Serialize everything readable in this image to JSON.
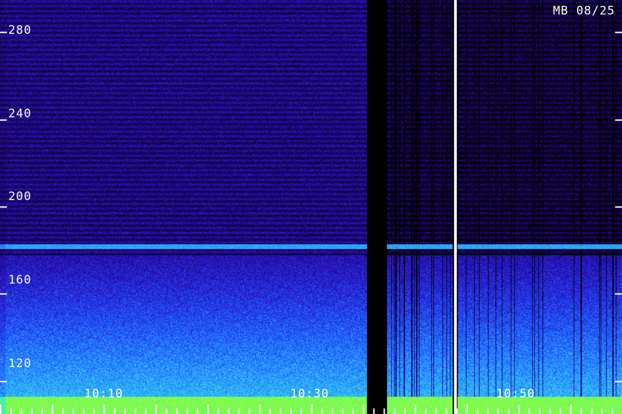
{
  "chart_data": {
    "type": "heatmap",
    "title": "MB 08/25",
    "xlabel": "",
    "ylabel": "",
    "x_ticks": [
      "10:10",
      "10:30",
      "10:50"
    ],
    "y_ticks": [
      120,
      160,
      200,
      240,
      280
    ],
    "ylim": [
      105,
      295
    ],
    "colormap": [
      "#000000",
      "#1a0566",
      "#2a10c0",
      "#1e5cff",
      "#33c0ff",
      "#30f0c0",
      "#a0ff20"
    ],
    "legend": "none",
    "grid": false
  }
}
